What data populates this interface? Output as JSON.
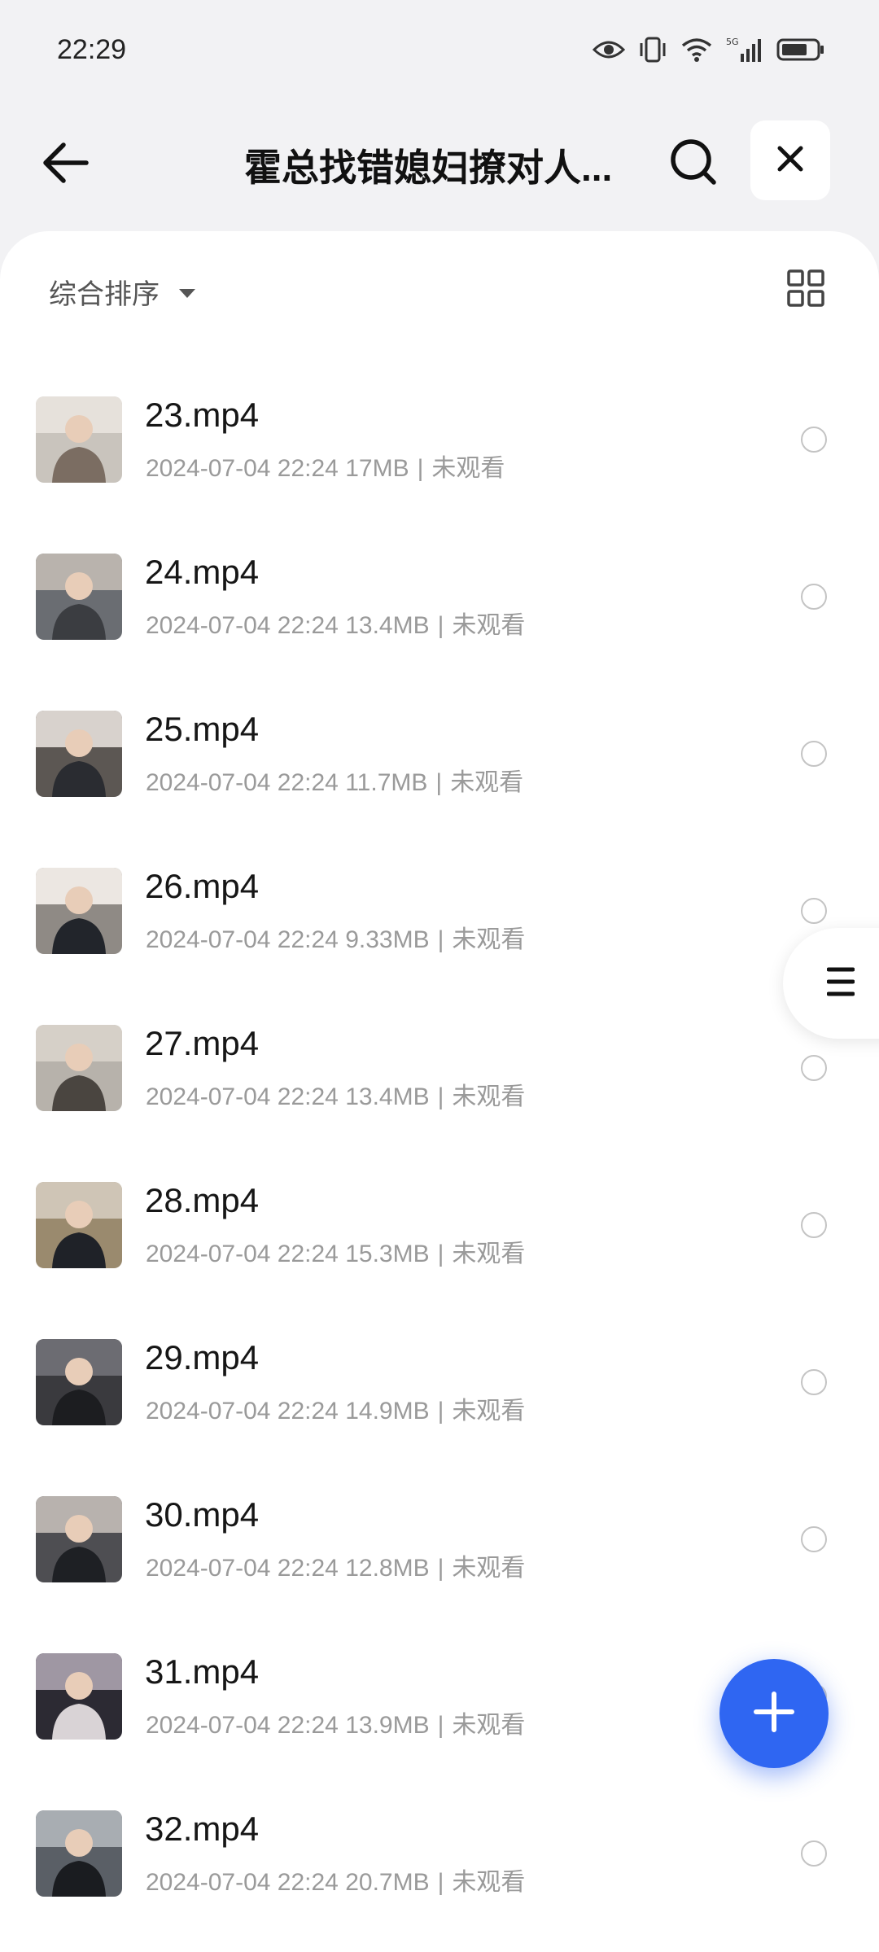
{
  "status_bar": {
    "time": "22:29",
    "icons": [
      "eye-icon",
      "vibrate-icon",
      "wifi-icon",
      "signal-5g-icon",
      "battery-icon"
    ]
  },
  "header": {
    "title": "霍总找错媳妇撩对人...",
    "back_icon": "back-arrow-icon",
    "search_icon": "search-icon",
    "close_icon": "close-icon"
  },
  "sort": {
    "label": "综合排序",
    "view_toggle_icon": "grid-view-icon"
  },
  "files": [
    {
      "name": "23.mp4",
      "date": "2024-07-04 22:24",
      "size": "17MB",
      "status": "未观看"
    },
    {
      "name": "24.mp4",
      "date": "2024-07-04 22:24",
      "size": "13.4MB",
      "status": "未观看"
    },
    {
      "name": "25.mp4",
      "date": "2024-07-04 22:24",
      "size": "11.7MB",
      "status": "未观看"
    },
    {
      "name": "26.mp4",
      "date": "2024-07-04 22:24",
      "size": "9.33MB",
      "status": "未观看"
    },
    {
      "name": "27.mp4",
      "date": "2024-07-04 22:24",
      "size": "13.4MB",
      "status": "未观看"
    },
    {
      "name": "28.mp4",
      "date": "2024-07-04 22:24",
      "size": "15.3MB",
      "status": "未观看"
    },
    {
      "name": "29.mp4",
      "date": "2024-07-04 22:24",
      "size": "14.9MB",
      "status": "未观看"
    },
    {
      "name": "30.mp4",
      "date": "2024-07-04 22:24",
      "size": "12.8MB",
      "status": "未观看"
    },
    {
      "name": "31.mp4",
      "date": "2024-07-04 22:24",
      "size": "13.9MB",
      "status": "未观看"
    },
    {
      "name": "32.mp4",
      "date": "2024-07-04 22:24",
      "size": "20.7MB",
      "status": "未观看"
    }
  ],
  "meta_separator": "|",
  "colors": {
    "accent": "#2f66f2",
    "background": "#f2f2f4",
    "card": "#ffffff",
    "meta_text": "#9a9a9a"
  },
  "fab_icon": "plus-icon",
  "index_handle_icon": "menu-lines-icon"
}
